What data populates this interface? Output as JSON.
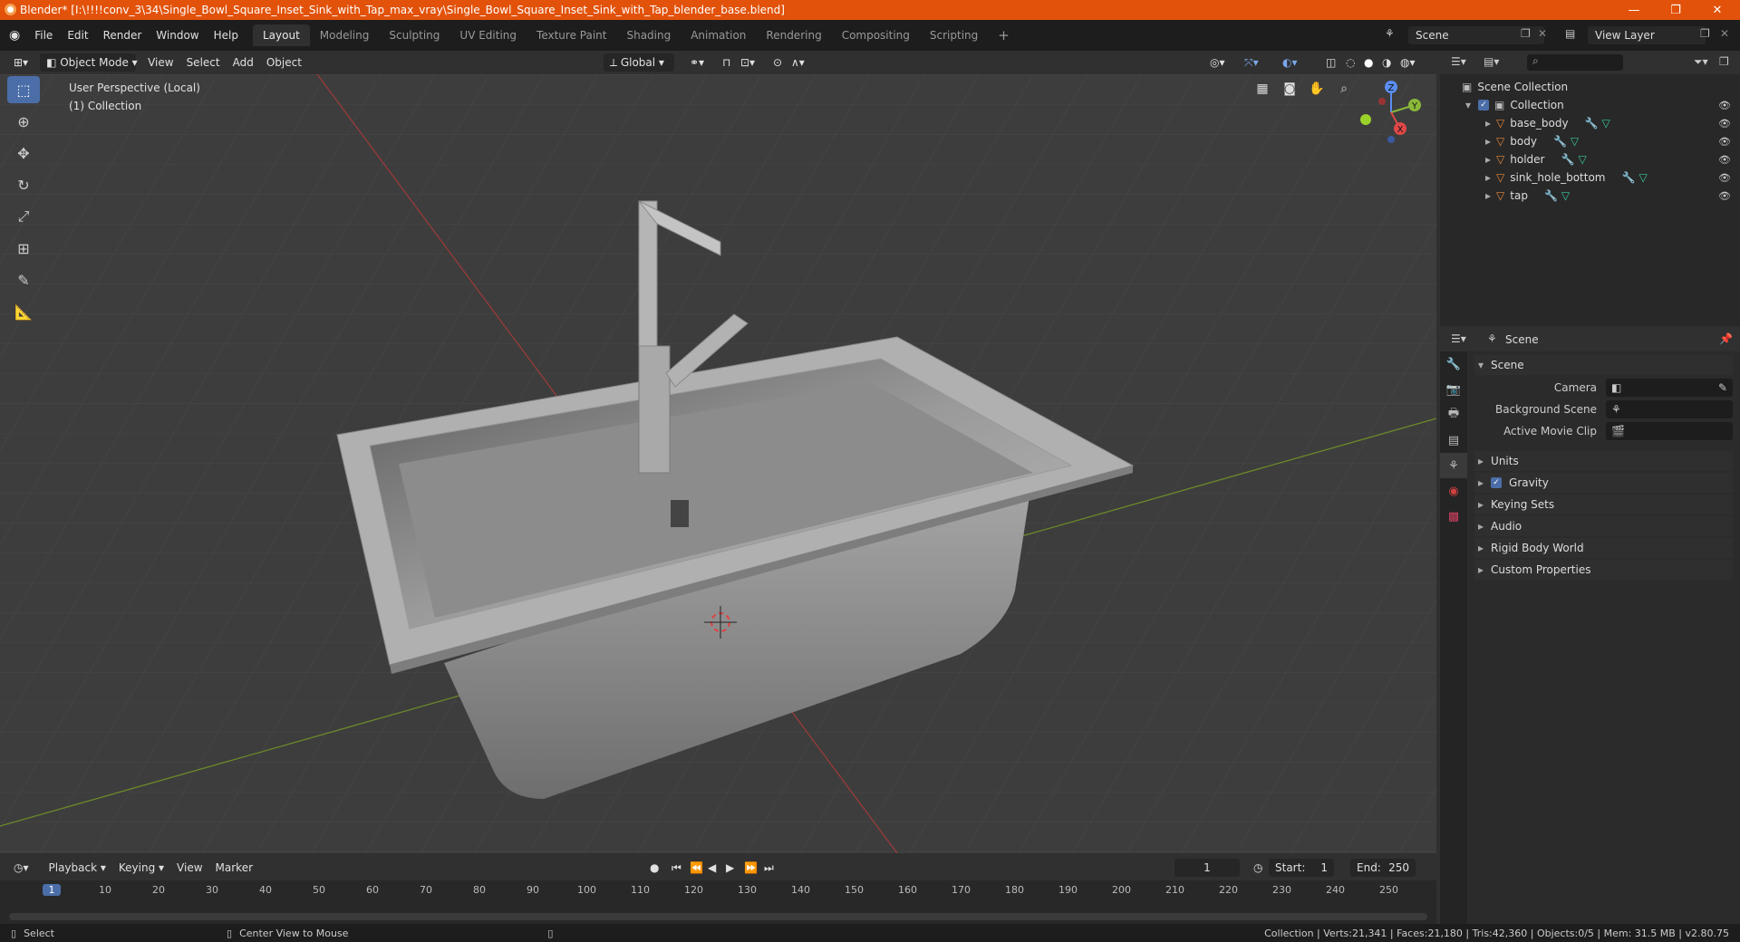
{
  "window": {
    "title": "Blender* [I:\\!!!!conv_3\\34\\Single_Bowl_Square_Inset_Sink_with_Tap_max_vray\\Single_Bowl_Square_Inset_Sink_with_Tap_blender_base.blend]",
    "minimize": "—",
    "maximize": "❐",
    "close": "✕"
  },
  "menu": [
    "File",
    "Edit",
    "Render",
    "Window",
    "Help"
  ],
  "workspaces": [
    "Layout",
    "Modeling",
    "Sculpting",
    "UV Editing",
    "Texture Paint",
    "Shading",
    "Animation",
    "Rendering",
    "Compositing",
    "Scripting"
  ],
  "workspace_add": "+",
  "scene": {
    "name": "Scene",
    "view_layer": "View Layer"
  },
  "viewport_header": {
    "mode": "Object Mode",
    "menus": [
      "View",
      "Select",
      "Add",
      "Object"
    ],
    "transform": "Global"
  },
  "viewport": {
    "perspective": "User Perspective (Local)",
    "collection": "(1) Collection",
    "axis_x": "X",
    "axis_y": "Y",
    "axis_z": "Z"
  },
  "outliner": {
    "root": "Scene Collection",
    "collection": "Collection",
    "objects": [
      "base_body",
      "body",
      "holder",
      "sink_hole_bottom",
      "tap"
    ]
  },
  "properties": {
    "context": "Scene",
    "section": "Scene",
    "fields": [
      {
        "label": "Camera",
        "value": ""
      },
      {
        "label": "Background Scene",
        "value": ""
      },
      {
        "label": "Active Movie Clip",
        "value": ""
      }
    ],
    "panels": [
      "Units",
      "Gravity",
      "Keying Sets",
      "Audio",
      "Rigid Body World",
      "Custom Properties"
    ]
  },
  "timeline": {
    "menus": [
      "Playback",
      "Keying",
      "View",
      "Marker"
    ],
    "current_frame": "1",
    "start_label": "Start:",
    "start": "1",
    "end_label": "End:",
    "end": "250",
    "ticks": [
      "1",
      "10",
      "20",
      "30",
      "40",
      "50",
      "60",
      "70",
      "80",
      "90",
      "100",
      "110",
      "120",
      "130",
      "140",
      "150",
      "160",
      "170",
      "180",
      "190",
      "200",
      "210",
      "220",
      "230",
      "240",
      "250"
    ]
  },
  "status": {
    "left": "Select",
    "middle": "Center View to Mouse",
    "right": "Collection | Verts:21,341 | Faces:21,180 | Tris:42,360 | Objects:0/5 | Mem: 31.5 MB | v2.80.75"
  }
}
